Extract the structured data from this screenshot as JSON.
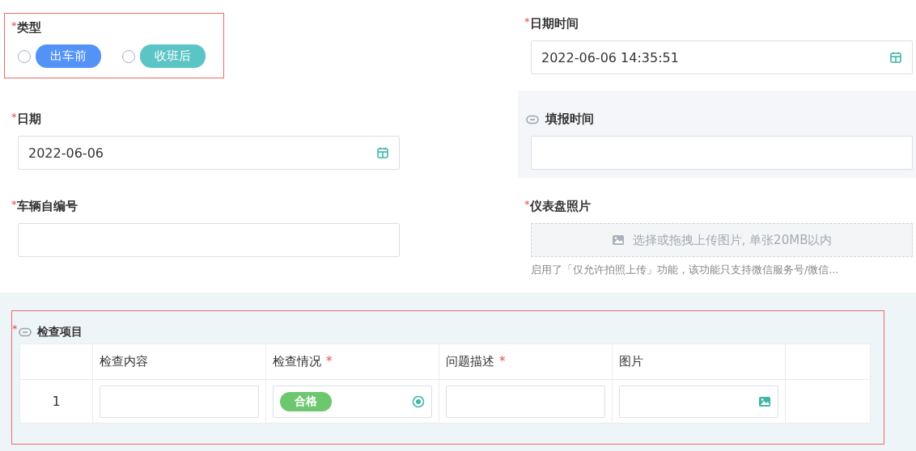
{
  "fields": [
    {
      "kind": "radio",
      "label": "类型",
      "required_mark": "*",
      "highlighted": true,
      "linked": false,
      "options": [
        {
          "label": "出车前",
          "color": "#5392f7",
          "selected": false
        },
        {
          "label": "收班后",
          "color": "#5bc4c4",
          "selected": false
        }
      ]
    },
    {
      "kind": "datetime",
      "label": "日期时间",
      "required_mark": "*",
      "highlighted": false,
      "linked": false,
      "value": "2022-06-06 14:35:51"
    },
    {
      "kind": "date",
      "label": "日期",
      "required_mark": "*",
      "highlighted": false,
      "linked": false,
      "value": "2022-06-06"
    },
    {
      "kind": "text",
      "label": "填报时间",
      "highlighted": false,
      "linked": true,
      "readonly": true
    },
    {
      "kind": "text",
      "label": "车辆自编号",
      "required_mark": "*",
      "highlighted": false,
      "linked": false
    },
    {
      "kind": "upload",
      "label": "仪表盘照片",
      "required_mark": "*",
      "highlighted": false,
      "linked": false,
      "placeholder": "选择或拖拽上传图片, 单张20MB以内",
      "hint": "启用了「仅允许拍照上传」功能，该功能只支持微信服务号/微信..."
    }
  ],
  "subform": {
    "title": "检查项目",
    "required_mark": "*",
    "linked": true,
    "highlighted": true,
    "columns": [
      {
        "label": "检查内容"
      },
      {
        "label": "检查情况",
        "required_mark": "*"
      },
      {
        "label": "问题描述",
        "required_mark": "*"
      },
      {
        "label": "图片"
      }
    ],
    "rows": [
      {
        "index": "1",
        "cells": [
          {
            "kind": "text"
          },
          {
            "kind": "status",
            "value": "合格",
            "color": "#6cc76f"
          },
          {
            "kind": "text"
          },
          {
            "kind": "image"
          }
        ]
      }
    ]
  }
}
